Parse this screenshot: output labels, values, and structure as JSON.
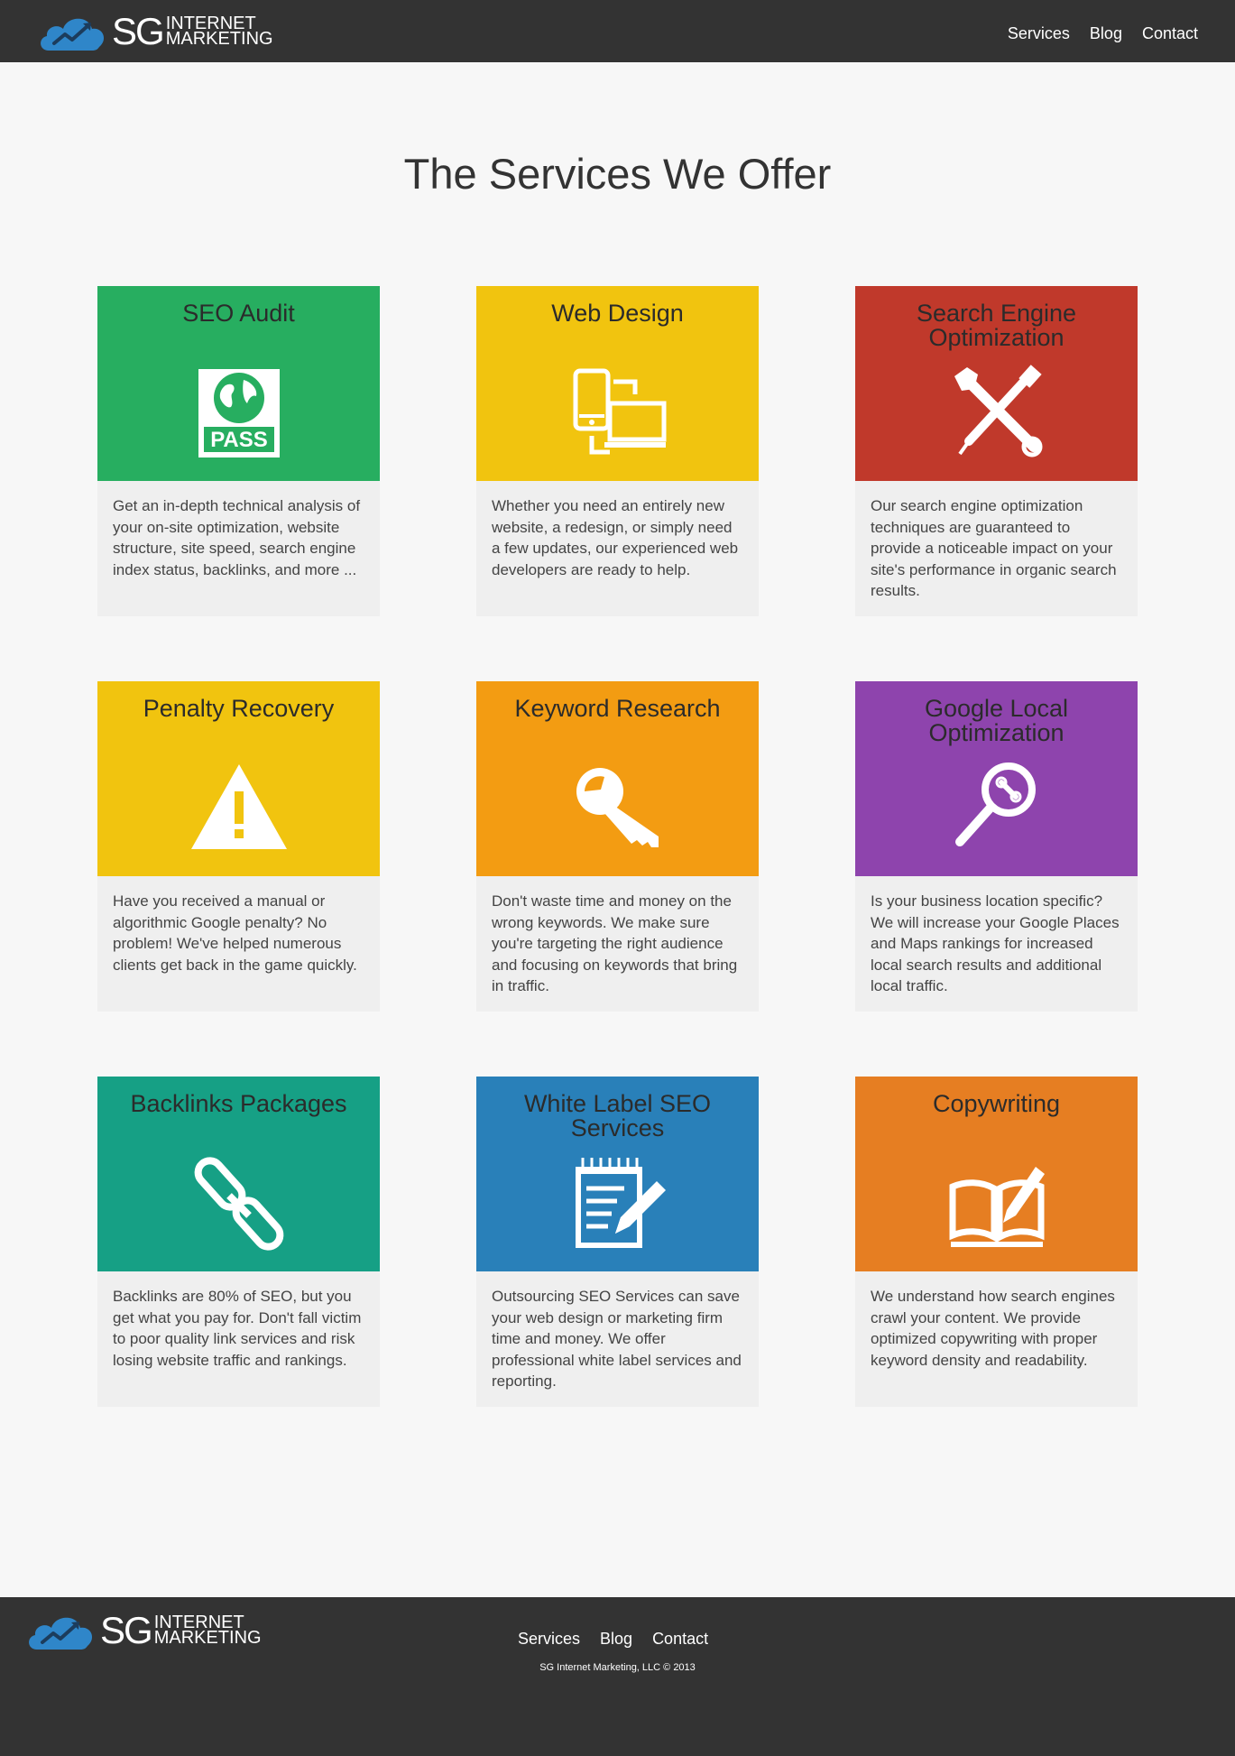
{
  "header": {
    "logo": {
      "sg": "SG",
      "line1": "INTERNET",
      "line2": "MARKETING"
    },
    "nav": [
      "Services",
      "Blog",
      "Contact"
    ]
  },
  "page_title": "The Services We Offer",
  "colors": {
    "bar": "#333333",
    "background": "#f7f7f7",
    "card_body": "#efefef",
    "brand_blue": "#2f86c9"
  },
  "services": [
    {
      "title": "SEO Audit",
      "icon": "pass-globe-icon",
      "color": "#27ae60",
      "text": "Get an in-depth technical analysis of your on-site optimization, website structure, site speed, search engine index status, backlinks, and more ..."
    },
    {
      "title": "Web Design",
      "icon": "devices-icon",
      "color": "#f1c40f",
      "text": "Whether you need an entirely new website, a redesign, or simply need a few updates, our experienced web developers are ready to help."
    },
    {
      "title": "Search Engine Optimization",
      "icon": "tools-icon",
      "color": "#c0392b",
      "text": "Our search engine optimization techniques are guaranteed to provide a noticeable impact on your site's performance in organic search results."
    },
    {
      "title": "Penalty Recovery",
      "icon": "warning-icon",
      "color": "#f1c40f",
      "text": "Have you received a manual or algorithmic Google penalty? No problem! We've helped numerous clients get back in the game quickly."
    },
    {
      "title": "Keyword Research",
      "icon": "key-icon",
      "color": "#f39c12",
      "text": "Don't waste time and money on the wrong keywords. We make sure you're targeting the right audience and focusing on keywords that bring in traffic."
    },
    {
      "title": "Google Local Optimization",
      "icon": "magnifier-icon",
      "color": "#8e44ad",
      "text": "Is your business location specific? We will increase your Google Places and Maps rankings for increased local search results and additional local traffic."
    },
    {
      "title": "Backlinks Packages",
      "icon": "chain-link-icon",
      "color": "#16a085",
      "text": "Backlinks are 80% of SEO, but you get what you pay for. Don't fall victim to poor quality link services and risk losing website traffic and rankings."
    },
    {
      "title": "White Label SEO Services",
      "icon": "notepad-pencil-icon",
      "color": "#2980b9",
      "text": "Outsourcing SEO Services can save your web design or marketing firm time and money. We offer professional white label services and reporting."
    },
    {
      "title": "Copywriting",
      "icon": "book-pencil-icon",
      "color": "#e67e22",
      "text": "We understand how search engines crawl your content. We provide optimized copywriting with proper keyword density and readability."
    }
  ],
  "footer": {
    "logo": {
      "sg": "SG",
      "line1": "INTERNET",
      "line2": "MARKETING"
    },
    "nav": [
      "Services",
      "Blog",
      "Contact"
    ],
    "copyright": "SG Internet Marketing, LLC © 2013"
  }
}
